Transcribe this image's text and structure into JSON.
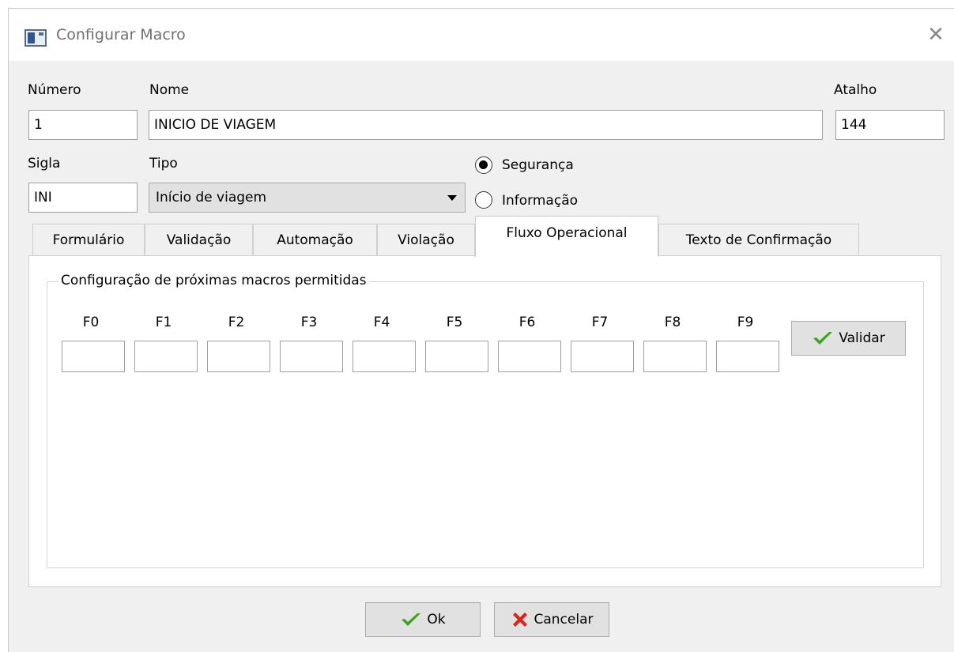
{
  "window": {
    "title": "Configurar Macro",
    "close_glyph": "✕"
  },
  "labels": {
    "numero": "Número",
    "nome": "Nome",
    "atalho": "Atalho",
    "sigla": "Sigla",
    "tipo": "Tipo"
  },
  "fields": {
    "numero": "1",
    "nome": "INICIO DE VIAGEM",
    "atalho": "144",
    "sigla": "INI"
  },
  "tipo_select": {
    "value": "Início de viagem"
  },
  "radios": [
    {
      "label": "Segurança",
      "checked": true
    },
    {
      "label": "Informação",
      "checked": false
    }
  ],
  "tabs": [
    {
      "label": "Formulário",
      "active": false
    },
    {
      "label": "Validação",
      "active": false
    },
    {
      "label": "Automação",
      "active": false
    },
    {
      "label": "Violação",
      "active": false
    },
    {
      "label": "Fluxo Operacional",
      "active": true
    },
    {
      "label": "Texto de Confirmação",
      "active": false
    }
  ],
  "group": {
    "title": "Configuração de próximas macros permitidas",
    "keys": [
      "F0",
      "F1",
      "F2",
      "F3",
      "F4",
      "F5",
      "F6",
      "F7",
      "F8",
      "F9"
    ],
    "values": [
      "",
      "",
      "",
      "",
      "",
      "",
      "",
      "",
      "",
      ""
    ],
    "validate_label": "Validar"
  },
  "footer": {
    "ok_label": "Ok",
    "cancel_label": "Cancelar"
  },
  "icons": {
    "check": "check-icon",
    "cancel": "x-icon",
    "window": "window-icon",
    "close": "close-icon"
  },
  "colors": {
    "check": "#3aa61a",
    "cancel": "#d9251c"
  }
}
